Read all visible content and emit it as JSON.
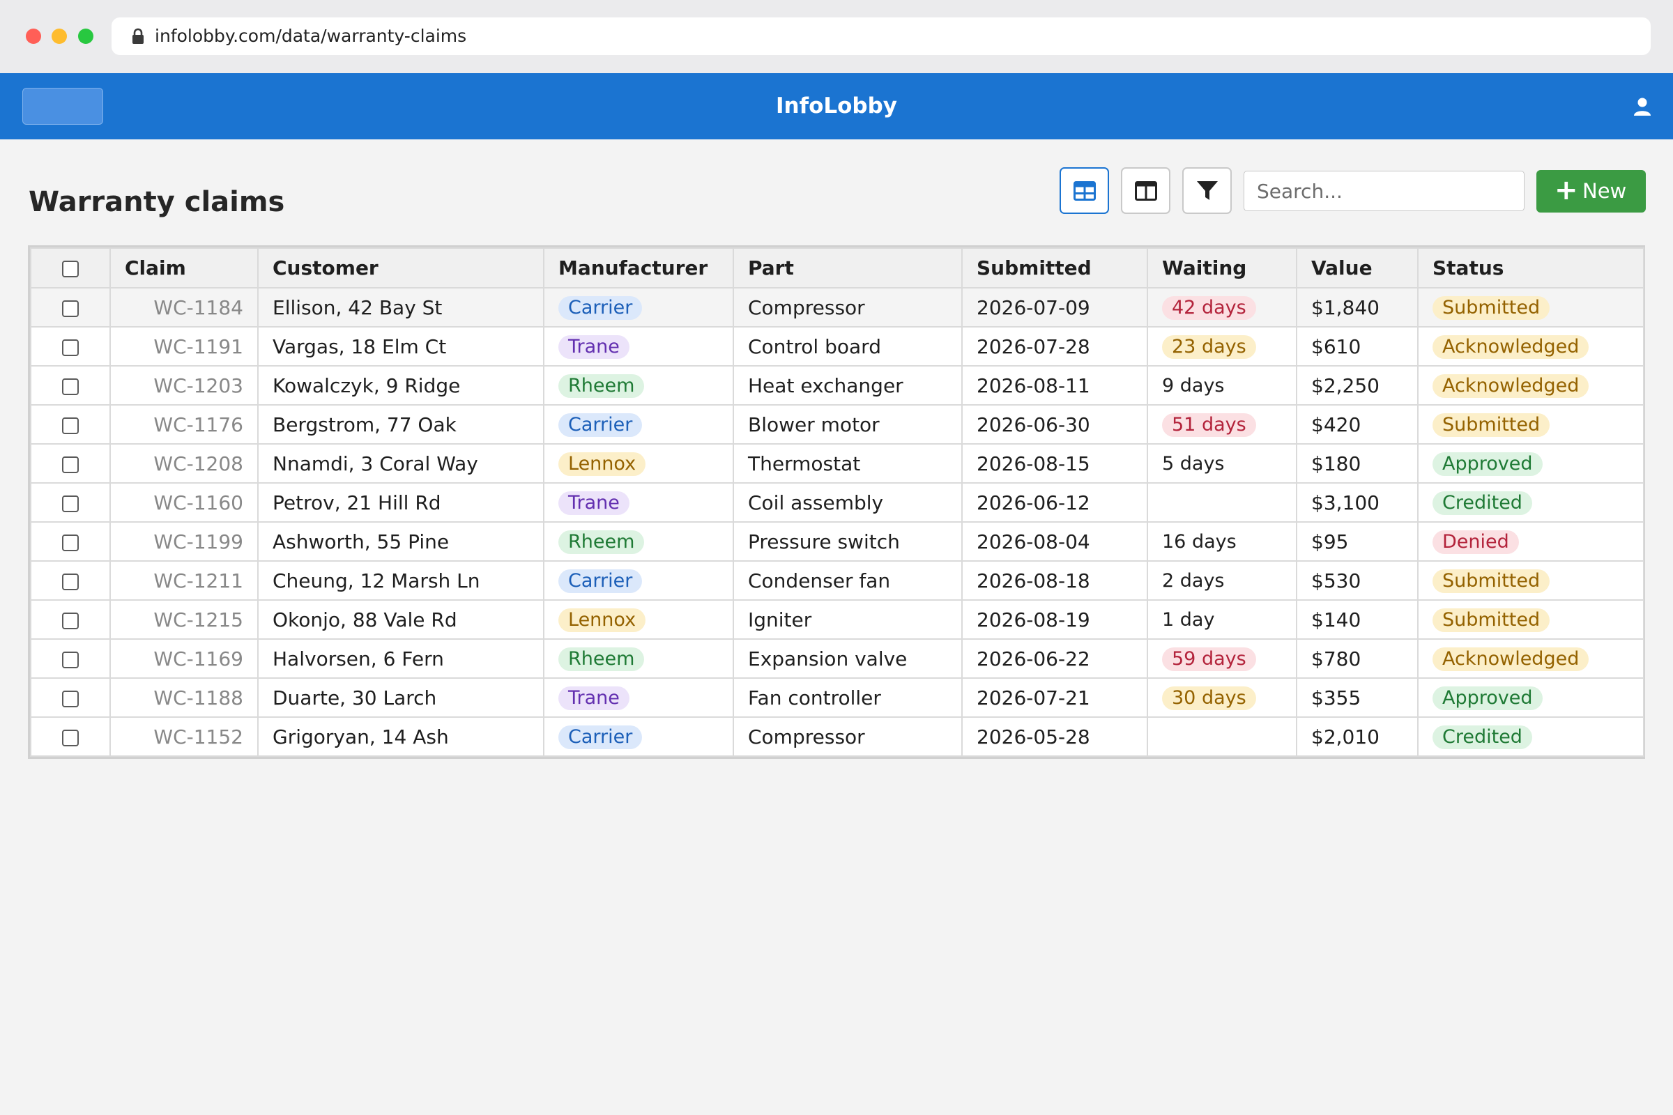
{
  "browser": {
    "url": "infolobby.com/data/warranty-claims"
  },
  "appbar": {
    "brand": "InfoLobby"
  },
  "page": {
    "title": "Warranty claims"
  },
  "toolbar": {
    "search_placeholder": "Search...",
    "new_label": "New",
    "icons": [
      "table-view-icon",
      "columns-view-icon",
      "filter-icon",
      "plus-icon",
      "user-icon",
      "lock-icon"
    ]
  },
  "table": {
    "columns": [
      "Claim",
      "Customer",
      "Manufacturer",
      "Part",
      "Submitted",
      "Waiting",
      "Value",
      "Status"
    ],
    "rows": [
      {
        "claim": "WC-1184",
        "customer": "Ellison, 42 Bay St",
        "manufacturer": "Carrier",
        "part": "Compressor",
        "submitted": "2026-07-09",
        "waiting": "42 days",
        "waiting_level": "red",
        "value": "$1,840",
        "status": "Submitted"
      },
      {
        "claim": "WC-1191",
        "customer": "Vargas, 18 Elm Ct",
        "manufacturer": "Trane",
        "part": "Control board",
        "submitted": "2026-07-28",
        "waiting": "23 days",
        "waiting_level": "yellow",
        "value": "$610",
        "status": "Acknowledged"
      },
      {
        "claim": "WC-1203",
        "customer": "Kowalczyk, 9 Ridge",
        "manufacturer": "Rheem",
        "part": "Heat exchanger",
        "submitted": "2026-08-11",
        "waiting": "9 days",
        "waiting_level": "none",
        "value": "$2,250",
        "status": "Acknowledged"
      },
      {
        "claim": "WC-1176",
        "customer": "Bergstrom, 77 Oak",
        "manufacturer": "Carrier",
        "part": "Blower motor",
        "submitted": "2026-06-30",
        "waiting": "51 days",
        "waiting_level": "red",
        "value": "$420",
        "status": "Submitted"
      },
      {
        "claim": "WC-1208",
        "customer": "Nnamdi, 3 Coral Way",
        "manufacturer": "Lennox",
        "part": "Thermostat",
        "submitted": "2026-08-15",
        "waiting": "5 days",
        "waiting_level": "none",
        "value": "$180",
        "status": "Approved"
      },
      {
        "claim": "WC-1160",
        "customer": "Petrov, 21 Hill Rd",
        "manufacturer": "Trane",
        "part": "Coil assembly",
        "submitted": "2026-06-12",
        "waiting": "",
        "waiting_level": "none",
        "value": "$3,100",
        "status": "Credited"
      },
      {
        "claim": "WC-1199",
        "customer": "Ashworth, 55 Pine",
        "manufacturer": "Rheem",
        "part": "Pressure switch",
        "submitted": "2026-08-04",
        "waiting": "16 days",
        "waiting_level": "none",
        "value": "$95",
        "status": "Denied"
      },
      {
        "claim": "WC-1211",
        "customer": "Cheung, 12 Marsh Ln",
        "manufacturer": "Carrier",
        "part": "Condenser fan",
        "submitted": "2026-08-18",
        "waiting": "2 days",
        "waiting_level": "none",
        "value": "$530",
        "status": "Submitted"
      },
      {
        "claim": "WC-1215",
        "customer": "Okonjo, 88 Vale Rd",
        "manufacturer": "Lennox",
        "part": "Igniter",
        "submitted": "2026-08-19",
        "waiting": "1 day",
        "waiting_level": "none",
        "value": "$140",
        "status": "Submitted"
      },
      {
        "claim": "WC-1169",
        "customer": "Halvorsen, 6 Fern",
        "manufacturer": "Rheem",
        "part": "Expansion valve",
        "submitted": "2026-06-22",
        "waiting": "59 days",
        "waiting_level": "red",
        "value": "$780",
        "status": "Acknowledged"
      },
      {
        "claim": "WC-1188",
        "customer": "Duarte, 30 Larch",
        "manufacturer": "Trane",
        "part": "Fan controller",
        "submitted": "2026-07-21",
        "waiting": "30 days",
        "waiting_level": "yellow",
        "value": "$355",
        "status": "Approved"
      },
      {
        "claim": "WC-1152",
        "customer": "Grigoryan, 14 Ash",
        "manufacturer": "Carrier",
        "part": "Compressor",
        "submitted": "2026-05-28",
        "waiting": "",
        "waiting_level": "none",
        "value": "$2,010",
        "status": "Credited"
      }
    ]
  },
  "colors": {
    "appbar": "#1b74d1",
    "new_button": "#3b9b43",
    "manufacturer": {
      "Carrier": {
        "bg": "#dbe8fb",
        "fg": "#1c5fb8"
      },
      "Trane": {
        "bg": "#ece3fa",
        "fg": "#6330b0"
      },
      "Rheem": {
        "bg": "#ddf3e2",
        "fg": "#1f7a35"
      },
      "Lennox": {
        "bg": "#fcefc9",
        "fg": "#946200"
      }
    },
    "status": {
      "Submitted": {
        "bg": "#fcefc9",
        "fg": "#946200"
      },
      "Acknowledged": {
        "bg": "#fcefc9",
        "fg": "#946200"
      },
      "Approved": {
        "bg": "#ddf3e2",
        "fg": "#1f7a35"
      },
      "Credited": {
        "bg": "#ddf3e2",
        "fg": "#1f7a35"
      },
      "Denied": {
        "bg": "#fbe0e3",
        "fg": "#b3233b"
      }
    },
    "waiting": {
      "red": {
        "bg": "#fbe0e3",
        "fg": "#b3233b"
      },
      "yellow": {
        "bg": "#fcefc9",
        "fg": "#946200"
      }
    }
  }
}
